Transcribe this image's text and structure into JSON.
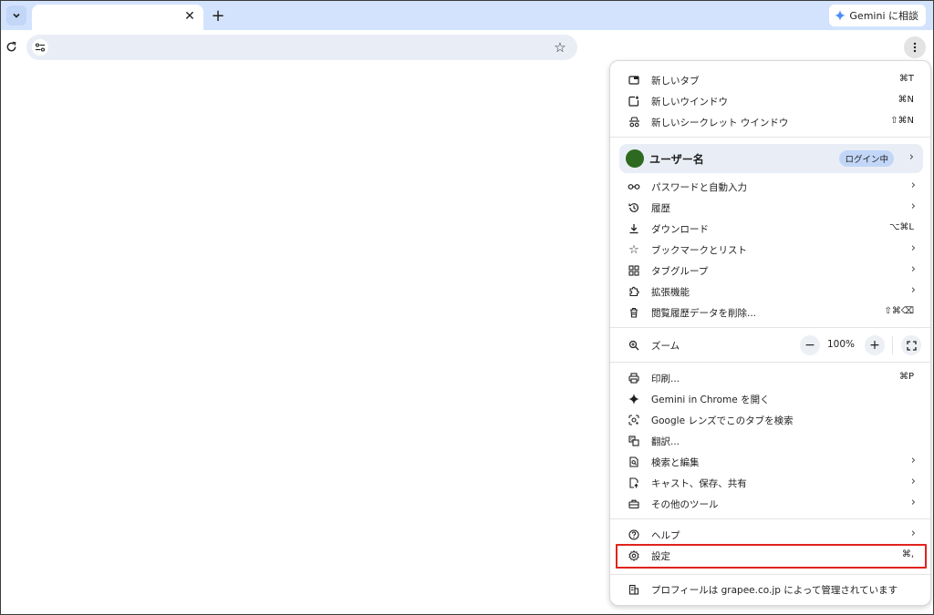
{
  "browser": {
    "gemini_button_label": "Gemini に相談",
    "omnibox_value": ""
  },
  "menu": {
    "new_items": [
      {
        "label": "新しいタブ",
        "shortcut": "⌘T",
        "icon": "new-tab-icon"
      },
      {
        "label": "新しいウインドウ",
        "shortcut": "⌘N",
        "icon": "new-window-icon"
      },
      {
        "label": "新しいシークレット ウインドウ",
        "shortcut": "⇧⌘N",
        "icon": "incognito-icon"
      }
    ],
    "profile": {
      "name": "ユーザー名",
      "badge": "ログイン中",
      "avatar_color": "#2d6a1f"
    },
    "section2": [
      {
        "label": "パスワードと自動入力",
        "icon": "key-icon",
        "submenu": true
      },
      {
        "label": "履歴",
        "icon": "history-icon",
        "submenu": true
      },
      {
        "label": "ダウンロード",
        "shortcut": "⌥⌘L",
        "icon": "download-icon"
      },
      {
        "label": "ブックマークとリスト",
        "icon": "star-icon",
        "submenu": true
      },
      {
        "label": "タブグループ",
        "icon": "tab-groups-icon",
        "submenu": true
      },
      {
        "label": "拡張機能",
        "icon": "extension-icon",
        "submenu": true
      },
      {
        "label": "閲覧履歴データを削除...",
        "shortcut": "⇧⌘⌫",
        "icon": "trash-icon"
      }
    ],
    "zoom": {
      "label": "ズーム",
      "value": "100%",
      "minus": "−",
      "plus": "+"
    },
    "section3": [
      {
        "label": "印刷...",
        "shortcut": "⌘P",
        "icon": "print-icon"
      },
      {
        "label": "Gemini in Chrome を開く",
        "icon": "gemini-icon"
      },
      {
        "label": "Google レンズでこのタブを検索",
        "icon": "lens-icon"
      },
      {
        "label": "翻訳...",
        "icon": "translate-icon"
      },
      {
        "label": "検索と編集",
        "icon": "search-edit-icon",
        "submenu": true
      },
      {
        "label": "キャスト、保存、共有",
        "icon": "cast-icon",
        "submenu": true
      },
      {
        "label": "その他のツール",
        "icon": "toolbox-icon",
        "submenu": true
      }
    ],
    "section4": [
      {
        "label": "ヘルプ",
        "icon": "help-icon",
        "submenu": true
      },
      {
        "label": "設定",
        "shortcut": "⌘,",
        "icon": "settings-icon"
      }
    ],
    "managed": {
      "label": "プロフィールは grapee.co.jp によって管理されています",
      "icon": "building-icon"
    },
    "chevron": "›"
  },
  "colors": {
    "tabstrip": "#d3e3fd",
    "highlight": "#e0231c"
  }
}
